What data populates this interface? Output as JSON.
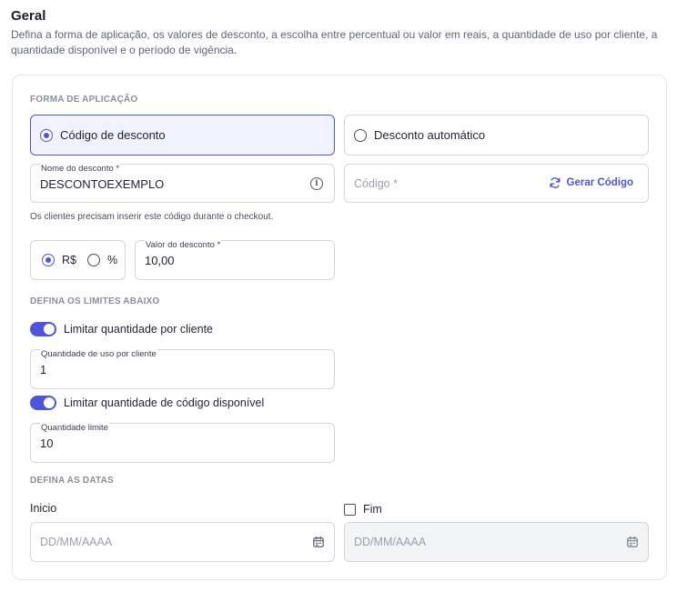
{
  "header": {
    "title": "Geral",
    "description": "Defina a forma de aplicação, os valores de desconto, a escolha entre percentual ou valor em reais, a quantidade de uso por cliente, a quantidade disponível e o período de vigência."
  },
  "application": {
    "section_label": "FORMA DE APLICAÇÃO",
    "option_code": "Código de desconto",
    "option_auto": "Desconto automático",
    "selected": "code"
  },
  "discount_name": {
    "label": "Nome do desconto *",
    "value": "DESCONTOEXEMPLO",
    "info_icon": "info-icon"
  },
  "code": {
    "placeholder": "Código *",
    "generate_label": "Gerar Código",
    "generate_icon": "refresh-icon"
  },
  "helper_text": "Os clientes precisam inserir este código durante o checkout.",
  "value_type": {
    "option_brl": "R$",
    "option_pct": "%",
    "selected": "brl"
  },
  "discount_value": {
    "label": "Valor do desconto *",
    "value": "10,00"
  },
  "limits": {
    "section_label": "DEFINA OS LIMITES ABAIXO",
    "per_customer_toggle": "Limitar quantidade por cliente",
    "per_customer_label": "Quantidade de uso por cliente",
    "per_customer_value": "1",
    "available_toggle": "Limitar quantidade de código disponível",
    "available_label": "Quantidade limite",
    "available_value": "10"
  },
  "dates": {
    "section_label": "DEFINA AS DATAS",
    "start_label": "Inicio",
    "end_label": "Fim",
    "start_placeholder": "DD/MM/AAAA",
    "end_placeholder": "DD/MM/AAAA"
  },
  "colors": {
    "accent": "#4f55d9",
    "selected_bg": "#f1f2ff",
    "border": "#d3d6dd"
  }
}
